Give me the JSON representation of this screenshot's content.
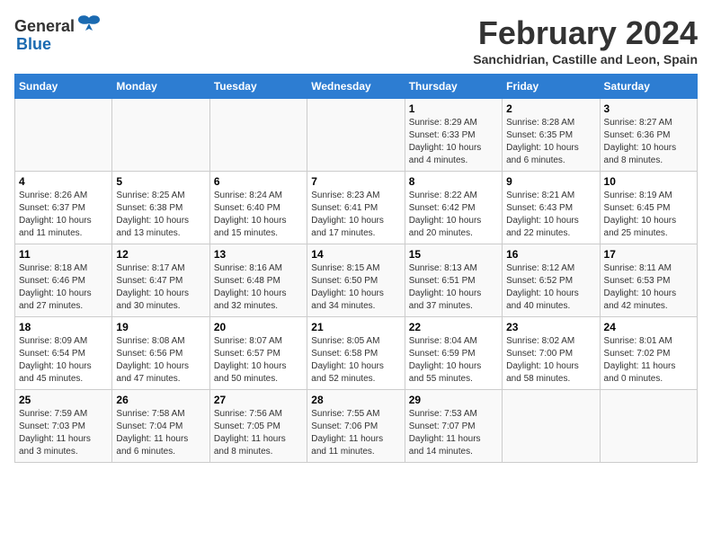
{
  "header": {
    "logo_general": "General",
    "logo_blue": "Blue",
    "month": "February 2024",
    "location": "Sanchidrian, Castille and Leon, Spain"
  },
  "days_of_week": [
    "Sunday",
    "Monday",
    "Tuesday",
    "Wednesday",
    "Thursday",
    "Friday",
    "Saturday"
  ],
  "weeks": [
    [
      {
        "day": "",
        "info": ""
      },
      {
        "day": "",
        "info": ""
      },
      {
        "day": "",
        "info": ""
      },
      {
        "day": "",
        "info": ""
      },
      {
        "day": "1",
        "info": "Sunrise: 8:29 AM\nSunset: 6:33 PM\nDaylight: 10 hours\nand 4 minutes."
      },
      {
        "day": "2",
        "info": "Sunrise: 8:28 AM\nSunset: 6:35 PM\nDaylight: 10 hours\nand 6 minutes."
      },
      {
        "day": "3",
        "info": "Sunrise: 8:27 AM\nSunset: 6:36 PM\nDaylight: 10 hours\nand 8 minutes."
      }
    ],
    [
      {
        "day": "4",
        "info": "Sunrise: 8:26 AM\nSunset: 6:37 PM\nDaylight: 10 hours\nand 11 minutes."
      },
      {
        "day": "5",
        "info": "Sunrise: 8:25 AM\nSunset: 6:38 PM\nDaylight: 10 hours\nand 13 minutes."
      },
      {
        "day": "6",
        "info": "Sunrise: 8:24 AM\nSunset: 6:40 PM\nDaylight: 10 hours\nand 15 minutes."
      },
      {
        "day": "7",
        "info": "Sunrise: 8:23 AM\nSunset: 6:41 PM\nDaylight: 10 hours\nand 17 minutes."
      },
      {
        "day": "8",
        "info": "Sunrise: 8:22 AM\nSunset: 6:42 PM\nDaylight: 10 hours\nand 20 minutes."
      },
      {
        "day": "9",
        "info": "Sunrise: 8:21 AM\nSunset: 6:43 PM\nDaylight: 10 hours\nand 22 minutes."
      },
      {
        "day": "10",
        "info": "Sunrise: 8:19 AM\nSunset: 6:45 PM\nDaylight: 10 hours\nand 25 minutes."
      }
    ],
    [
      {
        "day": "11",
        "info": "Sunrise: 8:18 AM\nSunset: 6:46 PM\nDaylight: 10 hours\nand 27 minutes."
      },
      {
        "day": "12",
        "info": "Sunrise: 8:17 AM\nSunset: 6:47 PM\nDaylight: 10 hours\nand 30 minutes."
      },
      {
        "day": "13",
        "info": "Sunrise: 8:16 AM\nSunset: 6:48 PM\nDaylight: 10 hours\nand 32 minutes."
      },
      {
        "day": "14",
        "info": "Sunrise: 8:15 AM\nSunset: 6:50 PM\nDaylight: 10 hours\nand 34 minutes."
      },
      {
        "day": "15",
        "info": "Sunrise: 8:13 AM\nSunset: 6:51 PM\nDaylight: 10 hours\nand 37 minutes."
      },
      {
        "day": "16",
        "info": "Sunrise: 8:12 AM\nSunset: 6:52 PM\nDaylight: 10 hours\nand 40 minutes."
      },
      {
        "day": "17",
        "info": "Sunrise: 8:11 AM\nSunset: 6:53 PM\nDaylight: 10 hours\nand 42 minutes."
      }
    ],
    [
      {
        "day": "18",
        "info": "Sunrise: 8:09 AM\nSunset: 6:54 PM\nDaylight: 10 hours\nand 45 minutes."
      },
      {
        "day": "19",
        "info": "Sunrise: 8:08 AM\nSunset: 6:56 PM\nDaylight: 10 hours\nand 47 minutes."
      },
      {
        "day": "20",
        "info": "Sunrise: 8:07 AM\nSunset: 6:57 PM\nDaylight: 10 hours\nand 50 minutes."
      },
      {
        "day": "21",
        "info": "Sunrise: 8:05 AM\nSunset: 6:58 PM\nDaylight: 10 hours\nand 52 minutes."
      },
      {
        "day": "22",
        "info": "Sunrise: 8:04 AM\nSunset: 6:59 PM\nDaylight: 10 hours\nand 55 minutes."
      },
      {
        "day": "23",
        "info": "Sunrise: 8:02 AM\nSunset: 7:00 PM\nDaylight: 10 hours\nand 58 minutes."
      },
      {
        "day": "24",
        "info": "Sunrise: 8:01 AM\nSunset: 7:02 PM\nDaylight: 11 hours\nand 0 minutes."
      }
    ],
    [
      {
        "day": "25",
        "info": "Sunrise: 7:59 AM\nSunset: 7:03 PM\nDaylight: 11 hours\nand 3 minutes."
      },
      {
        "day": "26",
        "info": "Sunrise: 7:58 AM\nSunset: 7:04 PM\nDaylight: 11 hours\nand 6 minutes."
      },
      {
        "day": "27",
        "info": "Sunrise: 7:56 AM\nSunset: 7:05 PM\nDaylight: 11 hours\nand 8 minutes."
      },
      {
        "day": "28",
        "info": "Sunrise: 7:55 AM\nSunset: 7:06 PM\nDaylight: 11 hours\nand 11 minutes."
      },
      {
        "day": "29",
        "info": "Sunrise: 7:53 AM\nSunset: 7:07 PM\nDaylight: 11 hours\nand 14 minutes."
      },
      {
        "day": "",
        "info": ""
      },
      {
        "day": "",
        "info": ""
      }
    ]
  ]
}
